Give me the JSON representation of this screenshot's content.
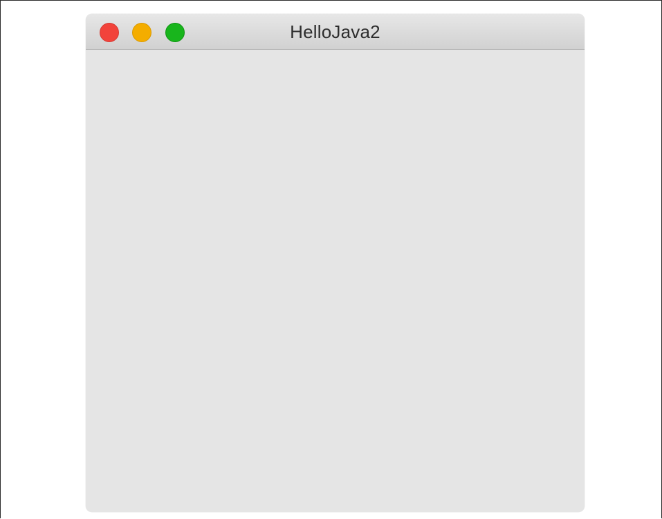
{
  "window": {
    "title": "HelloJava2",
    "buttons": {
      "close": {
        "color": "#f2433b",
        "border": "#d33a33"
      },
      "minimize": {
        "color": "#f4ad00",
        "border": "#d99900"
      },
      "zoom": {
        "color": "#18b51c",
        "border": "#0f9412"
      }
    },
    "content_background": "#e5e5e5"
  }
}
